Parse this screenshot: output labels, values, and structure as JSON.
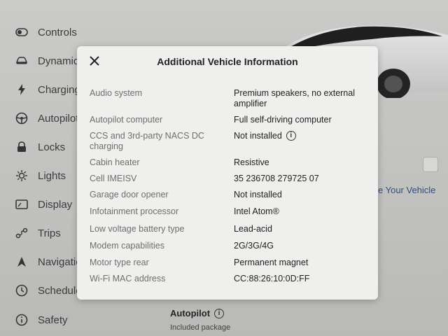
{
  "sidebar": {
    "items": [
      {
        "label": "Controls",
        "icon": "toggle-icon"
      },
      {
        "label": "Dynamics",
        "icon": "car-icon"
      },
      {
        "label": "Charging",
        "icon": "lightning-icon"
      },
      {
        "label": "Autopilot",
        "icon": "steering-wheel-icon"
      },
      {
        "label": "Locks",
        "icon": "lock-icon"
      },
      {
        "label": "Lights",
        "icon": "sun-icon"
      },
      {
        "label": "Display",
        "icon": "display-icon"
      },
      {
        "label": "Trips",
        "icon": "trips-icon"
      },
      {
        "label": "Navigation",
        "icon": "navigation-icon"
      },
      {
        "label": "Schedule",
        "icon": "clock-icon"
      },
      {
        "label": "Safety",
        "icon": "info-circle-icon"
      }
    ]
  },
  "background": {
    "link_text": "e Your Vehicle",
    "autopilot_heading": "Autopilot",
    "autopilot_sub": "Included package"
  },
  "modal": {
    "title": "Additional Vehicle Information",
    "close_icon": "close-icon",
    "rows": [
      {
        "key": "Audio system",
        "value": "Premium speakers, no external amplifier"
      },
      {
        "key": "Autopilot computer",
        "value": "Full self-driving computer"
      },
      {
        "key": "CCS and 3rd-party NACS DC charging",
        "value": "Not installed",
        "info": true
      },
      {
        "key": "Cabin heater",
        "value": "Resistive"
      },
      {
        "key": "Cell IMEISV",
        "value": "35 236708 279725 07"
      },
      {
        "key": "Garage door opener",
        "value": "Not installed"
      },
      {
        "key": "Infotainment processor",
        "value": "Intel Atom®"
      },
      {
        "key": "Low voltage battery type",
        "value": "Lead-acid"
      },
      {
        "key": "Modem capabilities",
        "value": "2G/3G/4G"
      },
      {
        "key": "Motor type rear",
        "value": "Permanent magnet"
      },
      {
        "key": "Wi-Fi MAC address",
        "value": "CC:88:26:10:0D:FF"
      }
    ]
  }
}
